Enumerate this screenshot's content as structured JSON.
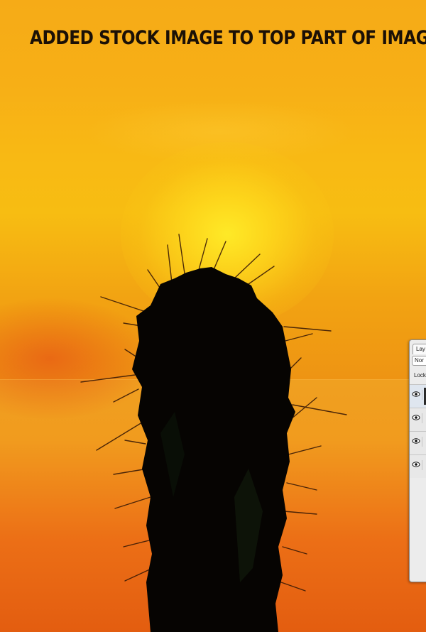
{
  "caption": "ADDED STOCK IMAGE TO TOP PART OF IMAGE",
  "colors": {
    "sky_orange": "#f6ab17",
    "sun_yellow": "#ffec28",
    "haze_red": "#e35d10",
    "silhouette": "#060402",
    "caption_text": "#1b1006"
  },
  "layers_panel": {
    "tab_label": "Lay",
    "blend_mode": "Nor",
    "lock_label": "Lock",
    "rows": [
      {
        "icon": "eye-icon",
        "selected": true
      },
      {
        "icon": "eye-icon",
        "selected": false
      },
      {
        "icon": "eye-icon",
        "selected": false
      },
      {
        "icon": "eye-icon",
        "selected": false
      }
    ]
  }
}
